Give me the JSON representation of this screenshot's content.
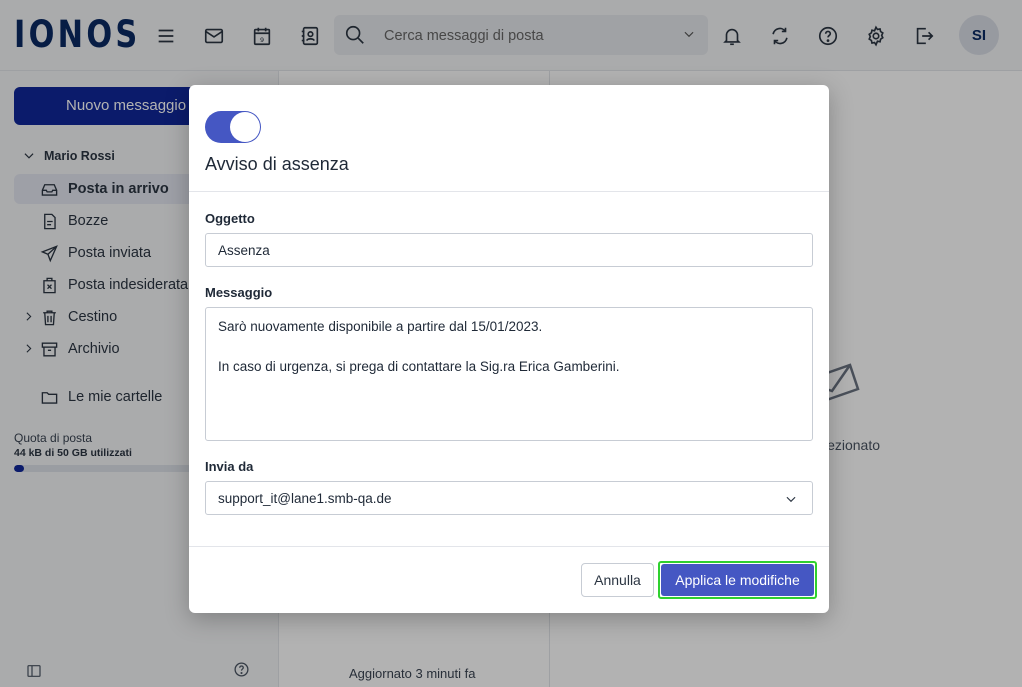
{
  "header": {
    "logo": "IONOS",
    "search_placeholder": "Cerca messaggi di posta",
    "avatar_initials": "SI"
  },
  "sidebar": {
    "new_message": "Nuovo messaggio",
    "account": "Mario Rossi",
    "folders": [
      {
        "label": "Posta in arrivo",
        "icon": "inbox-icon",
        "active": true
      },
      {
        "label": "Bozze",
        "icon": "draft-icon"
      },
      {
        "label": "Posta inviata",
        "icon": "send-icon"
      },
      {
        "label": "Posta indesiderata",
        "icon": "spam-icon"
      },
      {
        "label": "Cestino",
        "icon": "trash-icon",
        "expandable": true
      },
      {
        "label": "Archivio",
        "icon": "archive-icon",
        "expandable": true
      },
      {
        "label": "Le mie cartelle",
        "icon": "folder-icon"
      }
    ],
    "quota_label": "Quota di posta",
    "quota_value": "44 kB di 50 GB utilizzati",
    "quota_fraction": 0.04
  },
  "message_list": {
    "updated": "Aggiornato 3 minuti fa"
  },
  "reading_pane": {
    "empty_text": "ezionato"
  },
  "modal": {
    "toggle_on": true,
    "title": "Avviso di assenza",
    "subject_label": "Oggetto",
    "subject_value": "Assenza",
    "message_label": "Messaggio",
    "message_value": "Sarò nuovamente disponibile a partire dal 15/01/2023.\n\nIn caso di urgenza, si prega di contattare la Sig.ra Erica Gamberini.",
    "sender_label": "Invia da",
    "sender_value": "support_it@lane1.smb-qa.de",
    "cancel_label": "Annulla",
    "apply_label": "Applica le modifiche"
  },
  "colors": {
    "brand": "#0b2a63",
    "primary": "#4557c3",
    "highlight": "#2fd12f"
  }
}
